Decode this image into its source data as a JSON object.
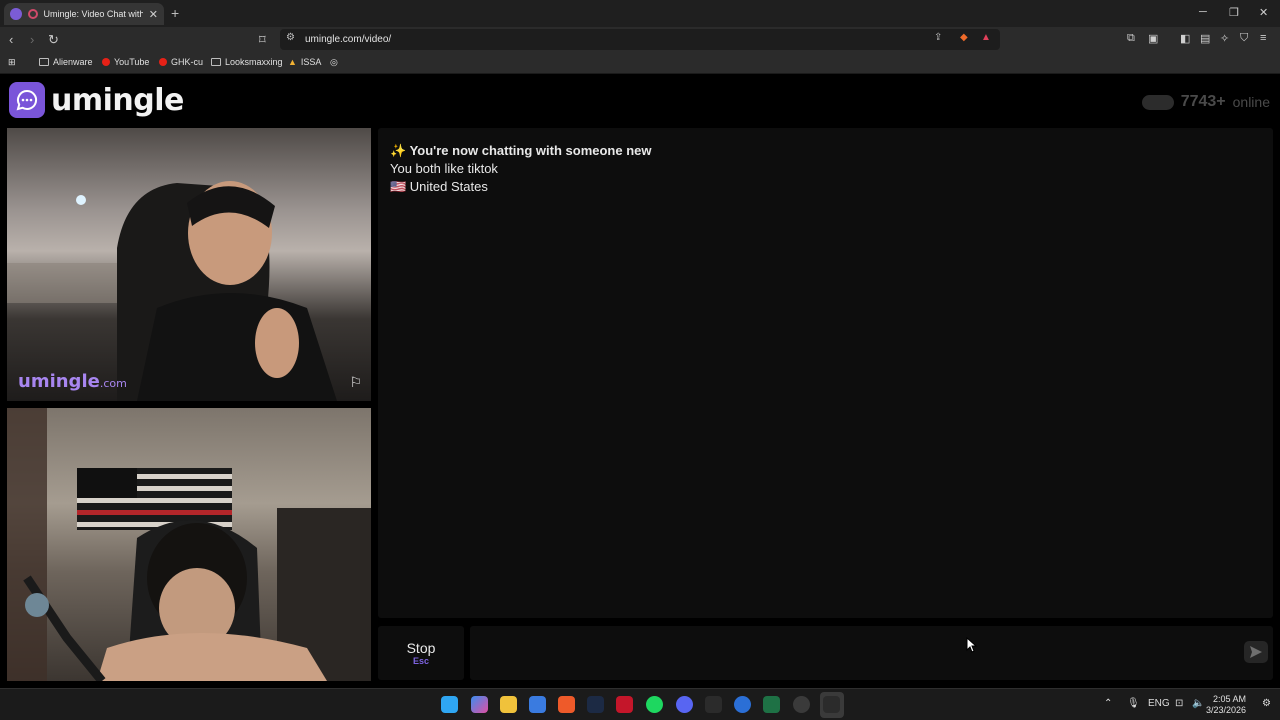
{
  "browser": {
    "tab_title": "Umingle: Video Chat with Strangers",
    "url": "umingle.com/video/",
    "bookmarks": [
      "Alienware",
      "YouTube",
      "GHK-cu",
      "Looksmaxxing",
      "ISSA"
    ]
  },
  "site": {
    "logo_text": "umingle",
    "online_count": "7743+",
    "online_label": "online",
    "watermark_main": "umingle",
    "watermark_suffix": ".com"
  },
  "chat": {
    "messages": [
      "✨ You're now chatting with someone new",
      "You both like tiktok",
      "🇺🇸 United States"
    ],
    "input_value": "",
    "input_placeholder": ""
  },
  "controls": {
    "stop_label": "Stop",
    "stop_key": "Esc"
  },
  "taskbar": {
    "lang": "ENG",
    "time": "2:05 AM",
    "date": "3/23/2026"
  },
  "colors": {
    "brand": "#7a55d9",
    "accent": "#7d63e0",
    "panel": "#0d0d0d"
  }
}
